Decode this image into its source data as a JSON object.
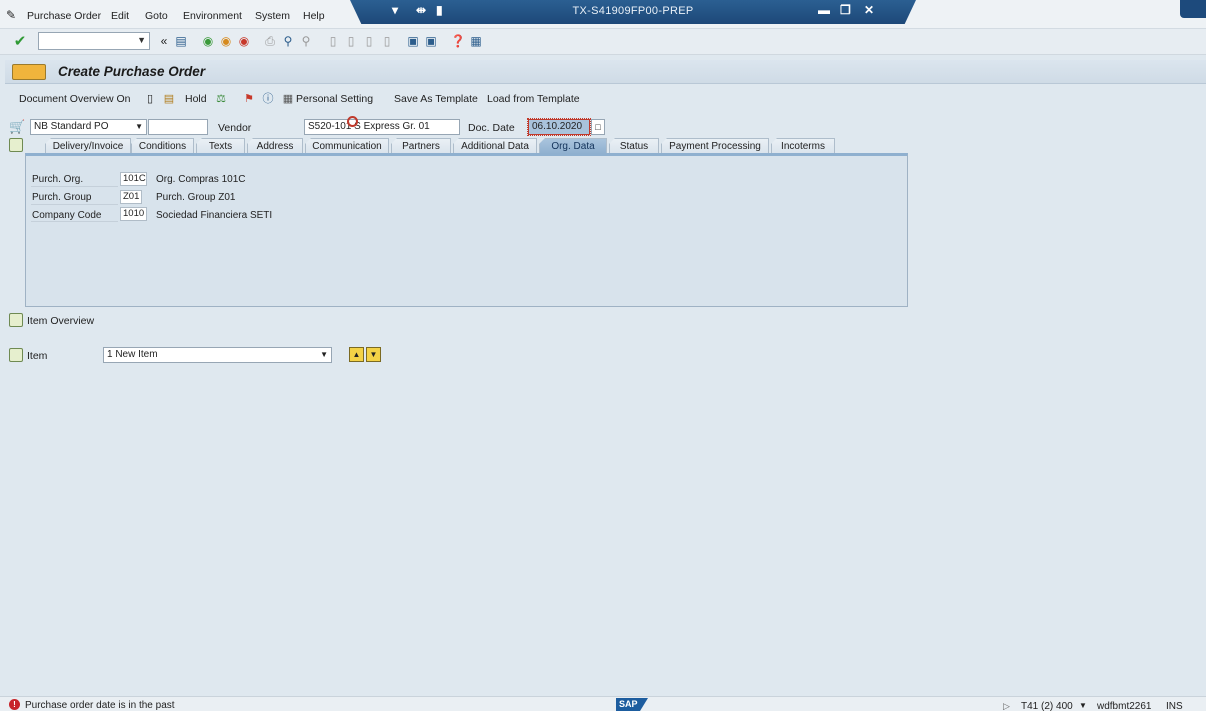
{
  "menu": {
    "items": [
      "Purchase Order",
      "Edit",
      "Goto",
      "Environment",
      "System",
      "Help"
    ]
  },
  "window": {
    "title": "TX-S41909FP00-PREP"
  },
  "page": {
    "title": "Create Purchase Order"
  },
  "app_toolbar": {
    "document_overview": "Document Overview On",
    "hold": "Hold",
    "personal_setting": "Personal Setting",
    "save_as_template": "Save As Template",
    "load_from_template": "Load from Template"
  },
  "header": {
    "doc_type": "NB Standard PO",
    "doc_number": "",
    "vendor_label": "Vendor",
    "vendor_value": "S520-101 S Express Gr. 01",
    "doc_date_label": "Doc. Date",
    "doc_date_value": "06.10.2020"
  },
  "tabs": [
    {
      "label": "Delivery/Invoice",
      "active": false
    },
    {
      "label": "Conditions",
      "active": false
    },
    {
      "label": "Texts",
      "active": false
    },
    {
      "label": "Address",
      "active": false
    },
    {
      "label": "Communication",
      "active": false
    },
    {
      "label": "Partners",
      "active": false
    },
    {
      "label": "Additional Data",
      "active": false
    },
    {
      "label": "Org. Data",
      "active": true
    },
    {
      "label": "Status",
      "active": false
    },
    {
      "label": "Payment Processing",
      "active": false
    },
    {
      "label": "Incoterms",
      "active": false
    }
  ],
  "org_data": [
    {
      "label": "Purch. Org.",
      "code": "101C",
      "desc": "Org. Compras 101C"
    },
    {
      "label": "Purch. Group",
      "code": "Z01",
      "desc": "Purch. Group Z01"
    },
    {
      "label": "Company Code",
      "code": "1010",
      "desc": "Sociedad Financiera SETI"
    }
  ],
  "item_section": {
    "overview_label": "Item Overview",
    "item_label": "Item",
    "item_value": "1 New Item"
  },
  "status_bar": {
    "message": "Purchase order date is in the past",
    "logo": "SAP",
    "session": "T41 (2) 400",
    "server": "wdfbmt2261",
    "mode": "INS"
  },
  "colors": {
    "title_bar": "#1d4878",
    "active_tab": "#8fb0cf",
    "error": "#c7242a"
  }
}
